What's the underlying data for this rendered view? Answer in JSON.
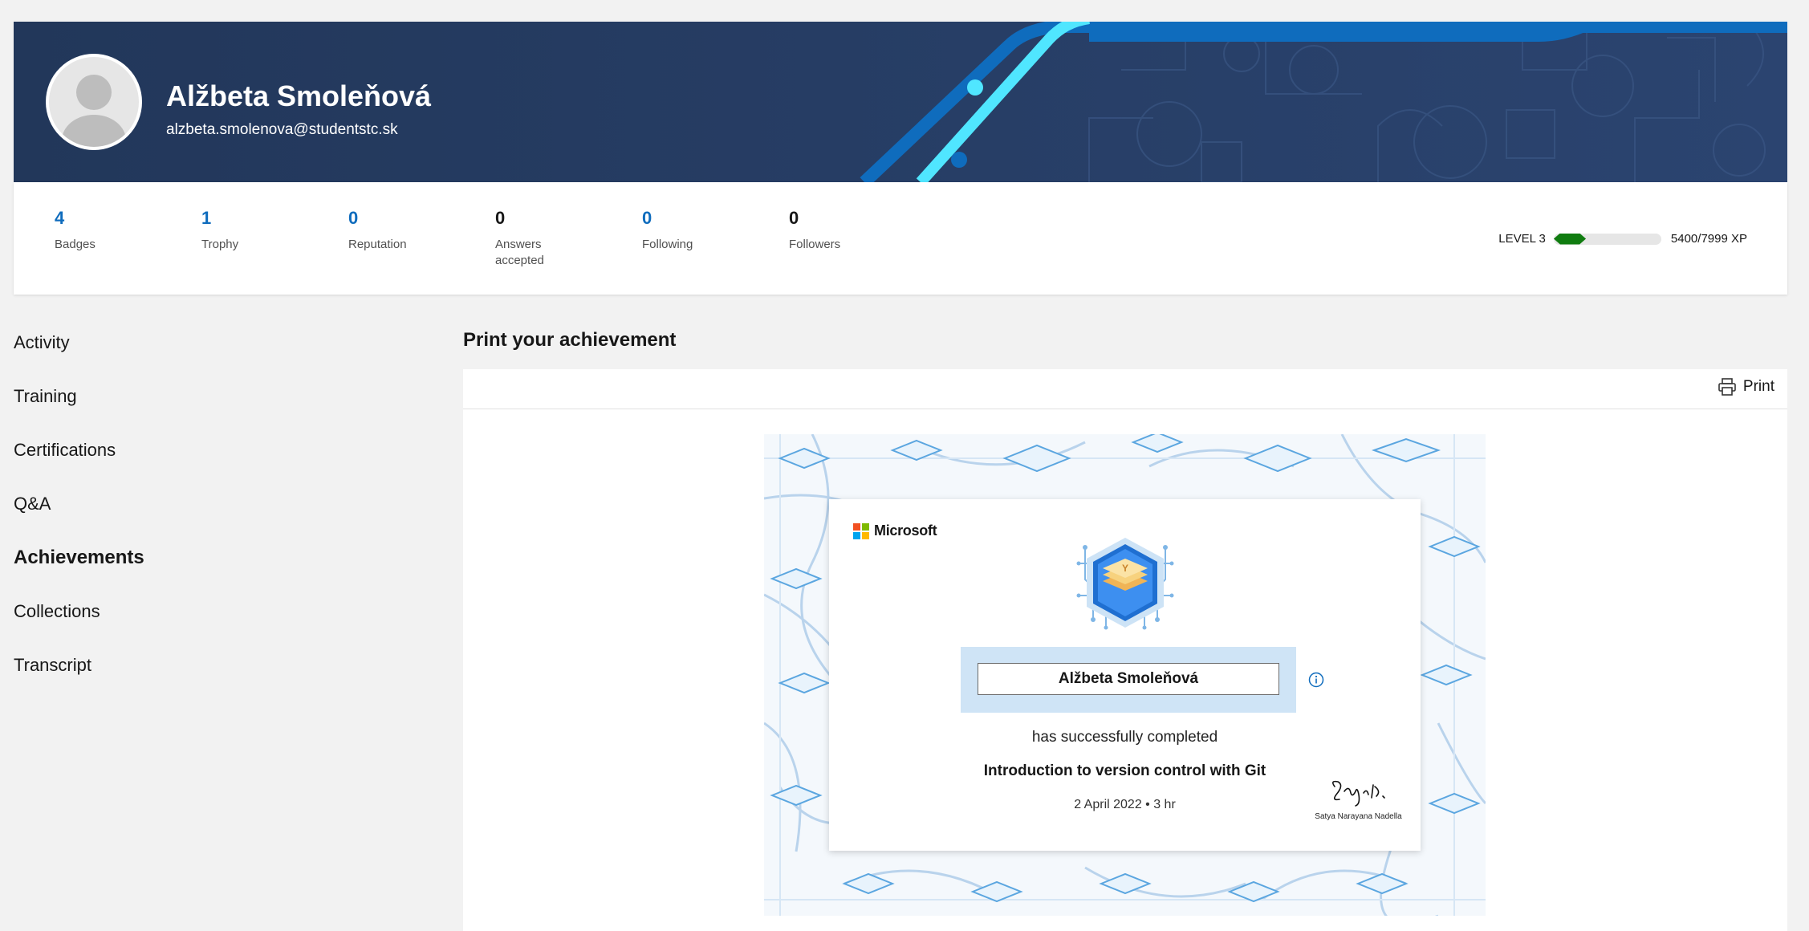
{
  "profile": {
    "name": "Alžbeta Smoleňová",
    "email": "alzbeta.smolenova@studentstc.sk"
  },
  "stats": [
    {
      "value": "4",
      "label": "Badges",
      "color": "#0f6cbd"
    },
    {
      "value": "1",
      "label": "Trophy",
      "color": "#0f6cbd"
    },
    {
      "value": "0",
      "label": "Reputation",
      "color": "#0f6cbd"
    },
    {
      "value": "0",
      "label": "Answers accepted",
      "color": "#171717"
    },
    {
      "value": "0",
      "label": "Following",
      "color": "#0f6cbd"
    },
    {
      "value": "0",
      "label": "Followers",
      "color": "#171717"
    }
  ],
  "level": {
    "label": "LEVEL 3",
    "xp_current": "5400",
    "xp_total": "/7999 XP",
    "progress": 0.3,
    "bar_color": "#107c10"
  },
  "nav": {
    "items": [
      {
        "label": "Activity",
        "active": false
      },
      {
        "label": "Training",
        "active": false
      },
      {
        "label": "Certifications",
        "active": false
      },
      {
        "label": "Q&A",
        "active": false
      },
      {
        "label": "Achievements",
        "active": true
      },
      {
        "label": "Collections",
        "active": false
      },
      {
        "label": "Transcript",
        "active": false
      }
    ]
  },
  "main": {
    "title": "Print your achievement",
    "print_label": "Print"
  },
  "certificate": {
    "brand": "Microsoft",
    "recipient": "Alžbeta Smoleňová",
    "completed_text": "has successfully completed",
    "course": "Introduction to version control with Git",
    "date_duration": "2 April 2022 • 3 hr",
    "signer": "Satya Narayana Nadella",
    "signature_text": "Satya N."
  },
  "colors": {
    "banner": "#243a5e",
    "accent": "#0f6cbd",
    "cert_band": "#cfe4f6"
  }
}
